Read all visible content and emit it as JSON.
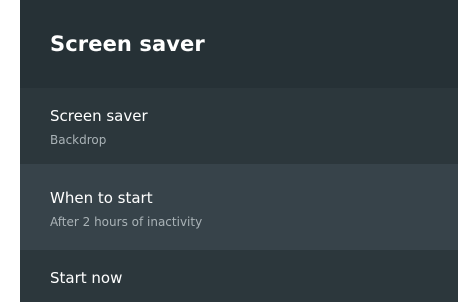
{
  "header": {
    "title": "Screen saver"
  },
  "items": [
    {
      "title": "Screen saver",
      "subtitle": "Backdrop"
    },
    {
      "title": "When to start",
      "subtitle": "After 2 hours of inactivity"
    },
    {
      "title": "Start now"
    }
  ],
  "colors": {
    "panel_bg": "#263136",
    "list_bg": "#2c373c",
    "focused_bg": "#37434a",
    "title_text": "#ffffff",
    "subtitle_text": "#a9b2b6"
  }
}
